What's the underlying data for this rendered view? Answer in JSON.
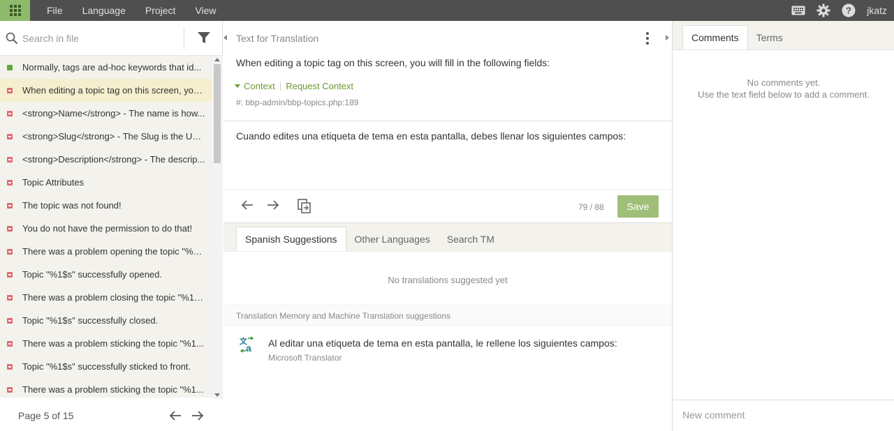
{
  "menu": [
    "File",
    "Language",
    "Project",
    "View"
  ],
  "user": "jkatz",
  "colors": {
    "topbar": "#4f4f4f",
    "brand": "#8dba6b",
    "accent": "#6b9a2f",
    "save": "#9fbf78"
  },
  "search": {
    "placeholder": "Search in file"
  },
  "list": [
    {
      "text": "Normally, tags are ad-hoc keywords that id...",
      "status": "translated"
    },
    {
      "text": "When editing a topic tag on this screen, you...",
      "status": "untranslated",
      "active": true
    },
    {
      "text": "<strong>Name</strong> - The name is how...",
      "status": "untranslated"
    },
    {
      "text": "<strong>Slug</strong> - The Slug is the URL...",
      "status": "untranslated"
    },
    {
      "text": "<strong>Description</strong> - The descrip...",
      "status": "untranslated"
    },
    {
      "text": "Topic Attributes",
      "status": "untranslated"
    },
    {
      "text": "The topic was not found!",
      "status": "untranslated"
    },
    {
      "text": "You do not have the permission to do that!",
      "status": "untranslated"
    },
    {
      "text": "There was a problem opening the topic \"%1...",
      "status": "untranslated"
    },
    {
      "text": "Topic \"%1$s\" successfully opened.",
      "status": "untranslated"
    },
    {
      "text": "There was a problem closing the topic \"%1$...",
      "status": "untranslated"
    },
    {
      "text": "Topic \"%1$s\" successfully closed.",
      "status": "untranslated"
    },
    {
      "text": "There was a problem sticking the topic \"%1...",
      "status": "untranslated"
    },
    {
      "text": "Topic \"%1$s\" successfully sticked to front.",
      "status": "untranslated"
    },
    {
      "text": "There was a problem sticking the topic \"%1...",
      "status": "untranslated"
    }
  ],
  "pager": {
    "label": "Page 5 of 15"
  },
  "source": {
    "header": "Text for Translation",
    "text": "When editing a topic tag on this screen, you will fill in the following fields:",
    "context_label": "Context",
    "request_context_label": "Request Context",
    "reference": "#: bbp-admin/bbp-topics.php:189"
  },
  "translation": {
    "text": "Cuando edites una etiqueta de tema en esta pantalla, debes llenar los siguientes campos:"
  },
  "toolbar": {
    "count": "79 / 88",
    "save_label": "Save"
  },
  "suggest_tabs": [
    "Spanish Suggestions",
    "Other Languages",
    "Search TM"
  ],
  "suggestions": {
    "empty": "No translations suggested yet"
  },
  "tm": {
    "header": "Translation Memory and Machine Translation suggestions",
    "items": [
      {
        "text": "Al editar una etiqueta de tema en esta pantalla, le rellene los siguientes campos:",
        "source": "Microsoft Translator",
        "icon": "translate-icon"
      }
    ]
  },
  "right_tabs": [
    "Comments",
    "Terms"
  ],
  "comments": {
    "empty_line1": "No comments yet.",
    "empty_line2": "Use the text field below to add a comment.",
    "new_placeholder": "New comment"
  }
}
